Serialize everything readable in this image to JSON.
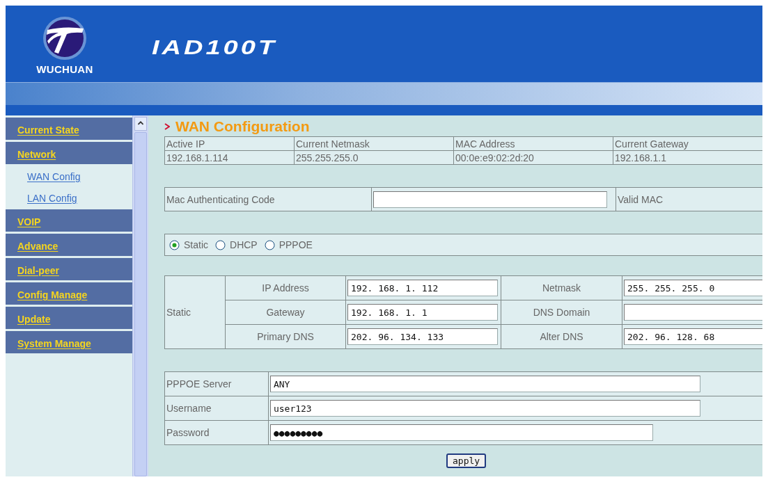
{
  "header": {
    "brand": "WUCHUAN",
    "product": "IAD100T"
  },
  "sidebar": {
    "items": [
      {
        "label": "Current State",
        "kind": "section"
      },
      {
        "label": "Network",
        "kind": "section"
      },
      {
        "label": "WAN Config",
        "kind": "link"
      },
      {
        "label": "LAN Config",
        "kind": "link"
      },
      {
        "label": "VOIP",
        "kind": "section"
      },
      {
        "label": "Advance",
        "kind": "section"
      },
      {
        "label": "Dial-peer",
        "kind": "section"
      },
      {
        "label": "Config Manage",
        "kind": "section"
      },
      {
        "label": "Update",
        "kind": "section"
      },
      {
        "label": "System Manage",
        "kind": "section"
      }
    ]
  },
  "page": {
    "title": "WAN Configuration",
    "status": {
      "columns": [
        "Active IP",
        "Current Netmask",
        "MAC Address",
        "Current Gateway"
      ],
      "values": [
        "192.168.1.114",
        "255.255.255.0",
        "00:0e:e9:02:2d:20",
        "192.168.1.1"
      ]
    },
    "mac_auth": {
      "label": "Mac Authenticating Code",
      "value_label": "Valid MAC"
    },
    "modes": [
      {
        "label": "Static",
        "selected": true
      },
      {
        "label": "DHCP",
        "selected": false
      },
      {
        "label": "PPPOE",
        "selected": false
      }
    ],
    "static": {
      "label": "Static",
      "rows": [
        {
          "label": "IP Address",
          "value": "192. 168. 1. 112",
          "label2": "Netmask",
          "value2": "255. 255. 255. 0"
        },
        {
          "label": "Gateway",
          "value": "192. 168. 1. 1",
          "label2": "DNS Domain"
        },
        {
          "label": "Primary DNS",
          "value": "202. 96. 134. 133",
          "label2": "Alter DNS",
          "value2": "202. 96. 128. 68"
        }
      ]
    },
    "pppoe": [
      {
        "label": "PPPOE Server",
        "value": "ANY"
      },
      {
        "label": "Username",
        "value": "user123"
      },
      {
        "label": "Password",
        "value": "●●●●●●●●●",
        "kind": "short"
      }
    ],
    "apply": "apply"
  }
}
